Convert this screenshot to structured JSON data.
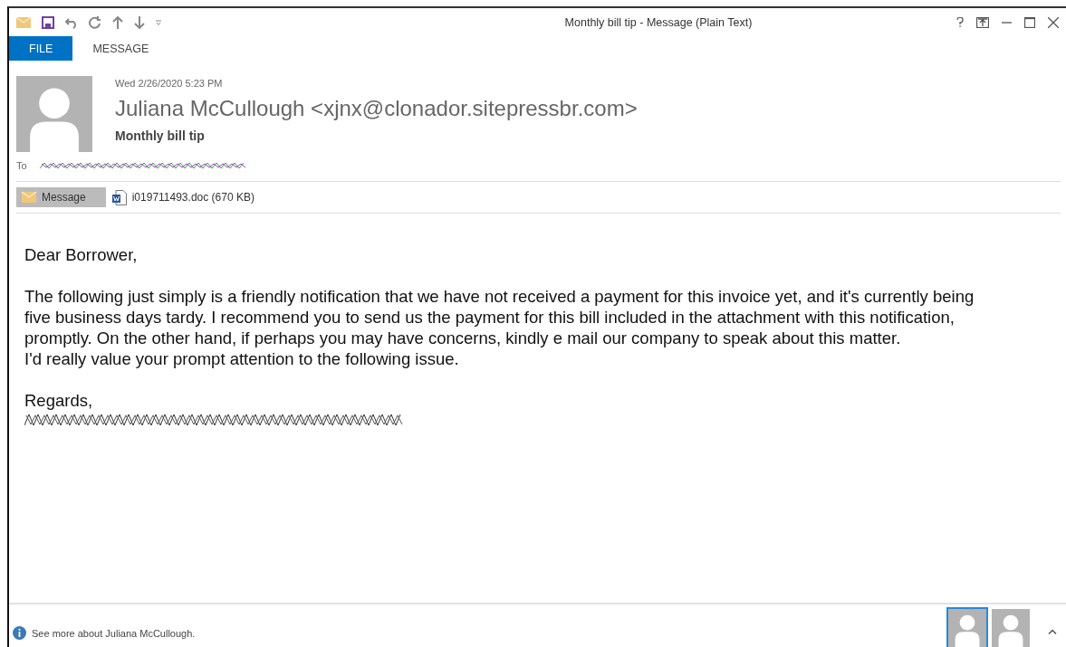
{
  "window": {
    "title": "Monthly bill tip - Message (Plain Text)"
  },
  "ribbon_tabs": [
    {
      "label": "FILE",
      "selected": true
    },
    {
      "label": "MESSAGE",
      "selected": false
    }
  ],
  "header": {
    "date": "Wed 2/26/2020 5:23 PM",
    "sender": "Juliana McCullough <xjnx@clonador.sitepressbr.com>",
    "subject": "Monthly bill tip",
    "to_label": "To"
  },
  "attachments": [
    {
      "kind": "message",
      "label": "Message",
      "selected": true
    },
    {
      "kind": "file",
      "label": "i019711493.doc (670 KB)",
      "selected": false
    }
  ],
  "body": [
    {
      "lines": [
        "Dear Borrower,"
      ]
    },
    {
      "lines": [
        "The following just simply is a friendly notification that we have not received a payment for this invoice yet, and it's currently being",
        "five business days tardy. I recommend you to send us the payment for this bill included in the attachment with this notification,",
        "promptly. On the other hand, if perhaps you may have concerns, kindly e mail our company to speak about this matter.",
        "I'd really value your prompt attention to the following issue."
      ]
    },
    {
      "lines": [
        "Regards,"
      ]
    }
  ],
  "people_pane": {
    "text": "See more about Juliana McCullough.",
    "avatars": [
      {
        "selected": true
      },
      {
        "selected": false
      }
    ]
  }
}
